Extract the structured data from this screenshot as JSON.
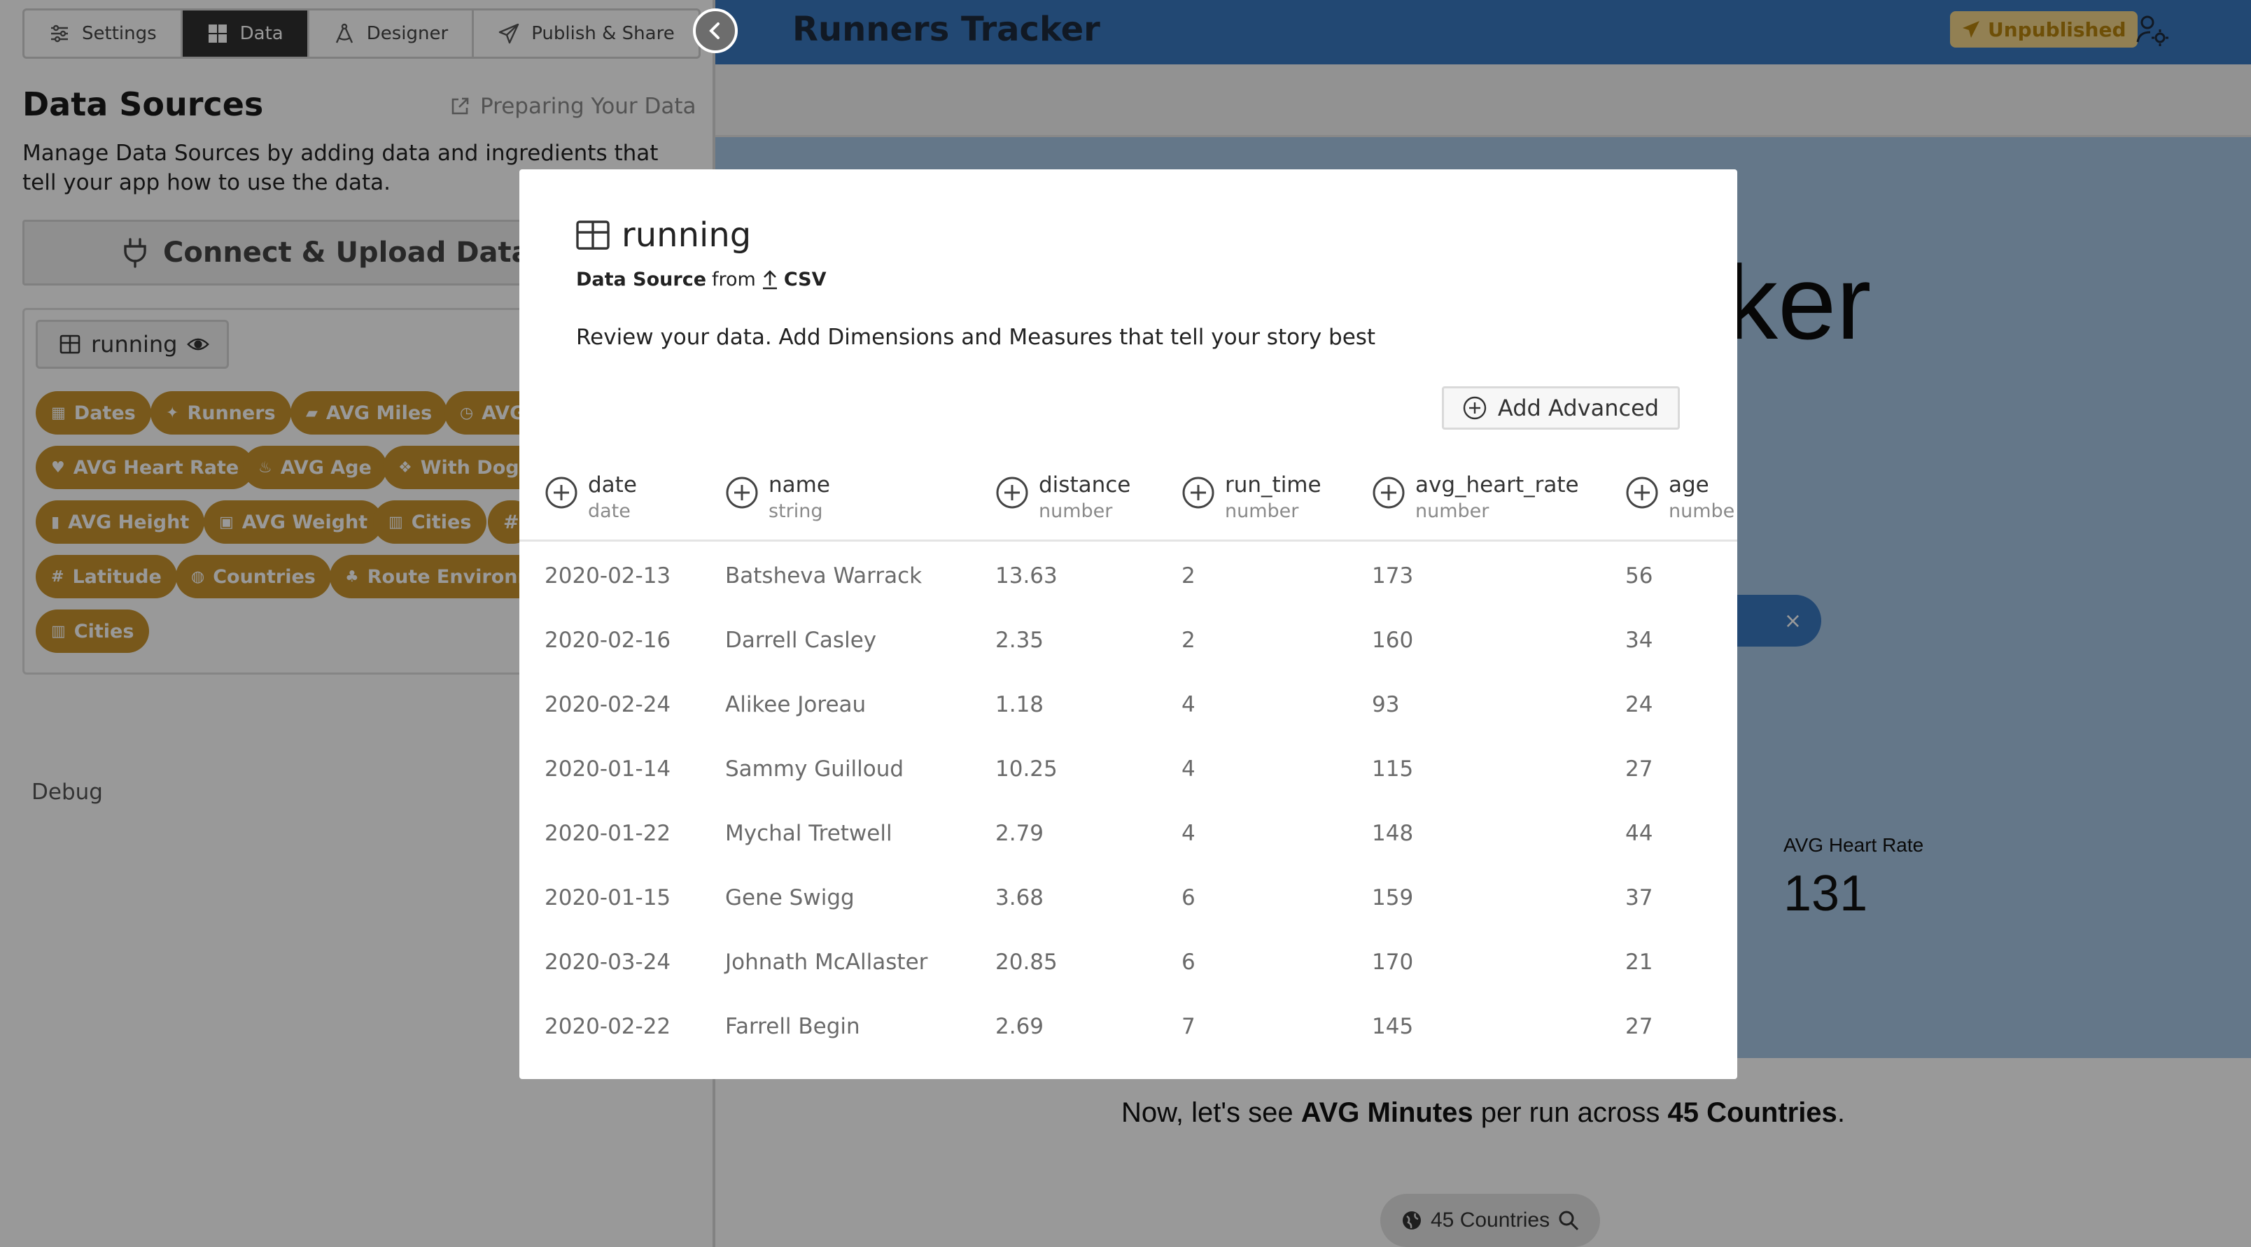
{
  "tabs": [
    {
      "label": "Settings",
      "icon": "sliders-icon",
      "active": false
    },
    {
      "label": "Data",
      "icon": "grid-icon",
      "active": true
    },
    {
      "label": "Designer",
      "icon": "compass-icon",
      "active": false
    },
    {
      "label": "Publish & Share",
      "icon": "paper-plane-icon",
      "active": false
    }
  ],
  "left": {
    "title": "Data Sources",
    "prep_link": "Preparing Your Data",
    "description": "Manage Data Sources by adding data and ingredients that tell your app how to use the data.",
    "connect_label": "Connect & Upload Data So",
    "source_chip": "running",
    "ingredients": [
      "Dates",
      "Runners",
      "AVG Miles",
      "AVG",
      "AVG Heart Rate",
      "AVG Age",
      "With Dogs",
      "AVG Height",
      "AVG Weight",
      "Cities",
      "#",
      "Latitude",
      "Countries",
      "Route Environm",
      "Cities"
    ],
    "debug": "Debug"
  },
  "app": {
    "title": "Runners Tracker",
    "unpublished": "Unpublished",
    "hero_title": "cker",
    "filter_chip_close": "×",
    "metric_label": "AVG Heart Rate",
    "metric_value": "131",
    "sentence_pre": "Now, let's see ",
    "sentence_b1": "AVG Minutes",
    "sentence_mid": " per run across ",
    "sentence_b2": "45 Countries",
    "sentence_end": ".",
    "countries_chip": "45 Countries"
  },
  "modal": {
    "title": "running",
    "sub_bold": "Data Source",
    "sub_from": "from",
    "sub_format": "CSV",
    "description": "Review your data. Add Dimensions and Measures that tell your story best",
    "add_advanced": "Add Advanced",
    "columns": [
      {
        "name": "date",
        "type": "date"
      },
      {
        "name": "name",
        "type": "string"
      },
      {
        "name": "distance",
        "type": "number"
      },
      {
        "name": "run_time",
        "type": "number"
      },
      {
        "name": "avg_heart_rate",
        "type": "number"
      },
      {
        "name": "age",
        "type": "numbe"
      }
    ],
    "rows": [
      [
        "2020-02-13",
        "Batsheva Warrack",
        "13.63",
        "2",
        "173",
        "56"
      ],
      [
        "2020-02-16",
        "Darrell Casley",
        "2.35",
        "2",
        "160",
        "34"
      ],
      [
        "2020-02-24",
        "Alikee Joreau",
        "1.18",
        "4",
        "93",
        "24"
      ],
      [
        "2020-01-14",
        "Sammy Guilloud",
        "10.25",
        "4",
        "115",
        "27"
      ],
      [
        "2020-01-22",
        "Mychal Tretwell",
        "2.79",
        "4",
        "148",
        "44"
      ],
      [
        "2020-01-15",
        "Gene Swigg",
        "3.68",
        "6",
        "159",
        "37"
      ],
      [
        "2020-03-24",
        "Johnath McAllaster",
        "20.85",
        "6",
        "170",
        "21"
      ],
      [
        "2020-02-22",
        "Farrell Begin",
        "2.69",
        "7",
        "145",
        "27"
      ]
    ]
  },
  "colors": {
    "header_blue": "#3a78c0",
    "pill_gold": "#c8932d",
    "hero_bg": "#a7c6e4",
    "badge_bg": "#f4d58a",
    "active_tab": "#2f2f2f"
  }
}
